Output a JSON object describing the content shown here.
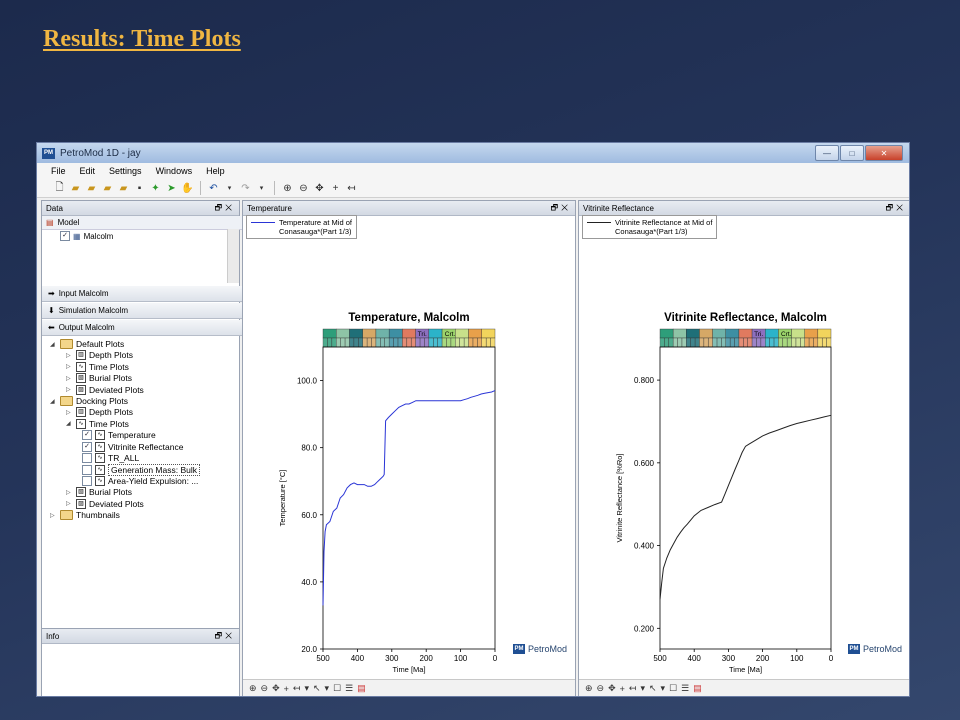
{
  "slide_title": "Results: Time Plots",
  "window": {
    "title": "PetroMod 1D - jay",
    "app_icon": "PM"
  },
  "menu": [
    "File",
    "Edit",
    "Settings",
    "Windows",
    "Help"
  ],
  "data_panel": {
    "header": "Data",
    "model_label": "Model",
    "model_item": "Malcolm",
    "actions": [
      "Input Malcolm",
      "Simulation Malcolm",
      "Output Malcolm"
    ],
    "tree": [
      {
        "label": "Default Plots",
        "level": 0,
        "kind": "folder",
        "open": true
      },
      {
        "label": "Depth Plots",
        "level": 1,
        "kind": "depth"
      },
      {
        "label": "Time Plots",
        "level": 1,
        "kind": "time"
      },
      {
        "label": "Burial Plots",
        "level": 1,
        "kind": "burial"
      },
      {
        "label": "Deviated Plots",
        "level": 1,
        "kind": "deviated"
      },
      {
        "label": "Docking Plots",
        "level": 0,
        "kind": "folder",
        "open": true
      },
      {
        "label": "Depth Plots",
        "level": 1,
        "kind": "depth"
      },
      {
        "label": "Time Plots",
        "level": 1,
        "kind": "time",
        "open": true
      },
      {
        "label": "Temperature",
        "level": 2,
        "checked": true
      },
      {
        "label": "Vitrinite Reflectance",
        "level": 2,
        "checked": true
      },
      {
        "label": "TR_ALL",
        "level": 2,
        "checked": false
      },
      {
        "label": "Generation Mass: Bulk",
        "level": 2,
        "checked": false,
        "selected": true
      },
      {
        "label": "Area-Yield Expulsion: ...",
        "level": 2,
        "checked": false
      },
      {
        "label": "Burial Plots",
        "level": 1,
        "kind": "burial"
      },
      {
        "label": "Deviated Plots",
        "level": 1,
        "kind": "deviated"
      },
      {
        "label": "Thumbnails",
        "level": 0,
        "kind": "folder"
      }
    ]
  },
  "info_panel": {
    "header": "Info"
  },
  "brand_label": "PetroMod",
  "strip_labels": {
    "tri": "Tri.",
    "crt": "Crt."
  },
  "temperature": {
    "header": "Temperature",
    "legend": [
      "Temperature at Mid of",
      "Conasauga*(Part 1/3)"
    ],
    "series_color": "#2a35d6"
  },
  "vitrinite": {
    "header": "Vitrinite Reflectance",
    "legend": [
      "Vitrinite Reflectance at Mid of",
      "Conasauga*(Part 1/3)"
    ],
    "series_color": "#222222"
  },
  "chart_data": [
    {
      "type": "line",
      "title": "Temperature, Malcolm",
      "xlabel": "Time [Ma]",
      "ylabel": "Temperature [°C]",
      "xlim": [
        500,
        0
      ],
      "ylim": [
        20,
        110
      ],
      "xticks": [
        500,
        400,
        300,
        200,
        100,
        0
      ],
      "yticks": [
        20.0,
        40.0,
        60.0,
        80.0,
        100.0
      ],
      "ytick_labels": [
        "20.0",
        "40.0",
        "60.0",
        "80.0",
        "100.0"
      ],
      "grid": false,
      "legend": "top-left",
      "series": [
        {
          "name": "Temperature at Mid of Conasauga*(Part 1/3)",
          "x": [
            500,
            497,
            494,
            490,
            480,
            470,
            460,
            450,
            440,
            430,
            420,
            410,
            400,
            390,
            380,
            370,
            360,
            350,
            340,
            335,
            330,
            325,
            322,
            320,
            318,
            310,
            300,
            290,
            280,
            270,
            260,
            250,
            240,
            230,
            220,
            210,
            200,
            190,
            180,
            170,
            160,
            150,
            140,
            130,
            120,
            110,
            100,
            90,
            80,
            70,
            60,
            50,
            40,
            30,
            20,
            10,
            0
          ],
          "y": [
            33,
            49,
            55,
            57,
            58,
            61,
            62,
            65,
            66,
            68,
            69,
            69.5,
            69,
            69,
            69,
            68.5,
            68.5,
            69,
            70,
            70.5,
            71,
            71.5,
            72,
            80,
            88,
            89,
            90,
            91,
            92,
            92.5,
            93,
            93,
            93.5,
            94,
            94,
            94,
            94,
            94,
            94,
            94,
            94,
            94,
            94,
            94,
            94,
            94,
            94,
            94.3,
            94.6,
            95,
            95.3,
            95.6,
            96,
            96.2,
            96.4,
            96.6,
            97
          ]
        }
      ]
    },
    {
      "type": "line",
      "title": "Vitrinite Reflectance, Malcolm",
      "xlabel": "Time [Ma]",
      "ylabel": "Vitrinite Reflectance [%Ro]",
      "xlim": [
        500,
        0
      ],
      "ylim": [
        0.15,
        0.88
      ],
      "xticks": [
        500,
        400,
        300,
        200,
        100,
        0
      ],
      "yticks": [
        0.2,
        0.4,
        0.6,
        0.8
      ],
      "ytick_labels": [
        "0.200",
        "0.400",
        "0.600",
        "0.800"
      ],
      "grid": false,
      "legend": "top-left",
      "series": [
        {
          "name": "Vitrinite Reflectance at Mid of Conasauga*(Part 1/3)",
          "x": [
            500,
            495,
            490,
            480,
            470,
            460,
            450,
            440,
            430,
            420,
            410,
            400,
            380,
            360,
            340,
            320,
            310,
            300,
            290,
            280,
            270,
            260,
            250,
            240,
            220,
            200,
            180,
            160,
            140,
            120,
            100,
            80,
            60,
            40,
            20,
            0
          ],
          "y": [
            0.27,
            0.31,
            0.345,
            0.37,
            0.39,
            0.405,
            0.42,
            0.432,
            0.443,
            0.452,
            0.462,
            0.472,
            0.485,
            0.492,
            0.499,
            0.505,
            0.525,
            0.545,
            0.565,
            0.585,
            0.605,
            0.625,
            0.64,
            0.645,
            0.655,
            0.665,
            0.672,
            0.678,
            0.684,
            0.69,
            0.695,
            0.699,
            0.703,
            0.707,
            0.711,
            0.715
          ]
        }
      ]
    }
  ]
}
